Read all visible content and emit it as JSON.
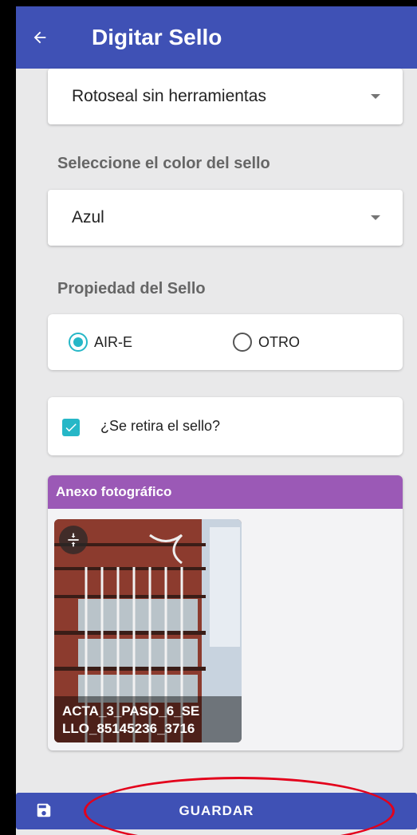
{
  "header": {
    "title": "Digitar Sello"
  },
  "seal_type": {
    "selected": "Rotoseal sin herramientas"
  },
  "seal_color": {
    "label": "Seleccione el color del sello",
    "selected": "Azul"
  },
  "ownership": {
    "label": "Propiedad del Sello",
    "options": [
      {
        "label": "AIR-E",
        "checked": true
      },
      {
        "label": "OTRO",
        "checked": false
      }
    ]
  },
  "removal": {
    "label": "¿Se retira el sello?",
    "checked": true
  },
  "annex": {
    "title": "Anexo fotográfico",
    "photo_caption_line1": "ACTA_3_PASO_6_SE",
    "photo_caption_line2": "LLO_85145236_3716"
  },
  "footer": {
    "save_label": "GUARDAR"
  },
  "colors": {
    "primary": "#3f51b5",
    "accent": "#26b7c7",
    "annex_header": "#9b59b6",
    "annotation": "#e3001b"
  },
  "icons": [
    "arrow-back-icon",
    "dropdown-arrow-icon",
    "check-icon",
    "compress-icon",
    "save-icon"
  ]
}
